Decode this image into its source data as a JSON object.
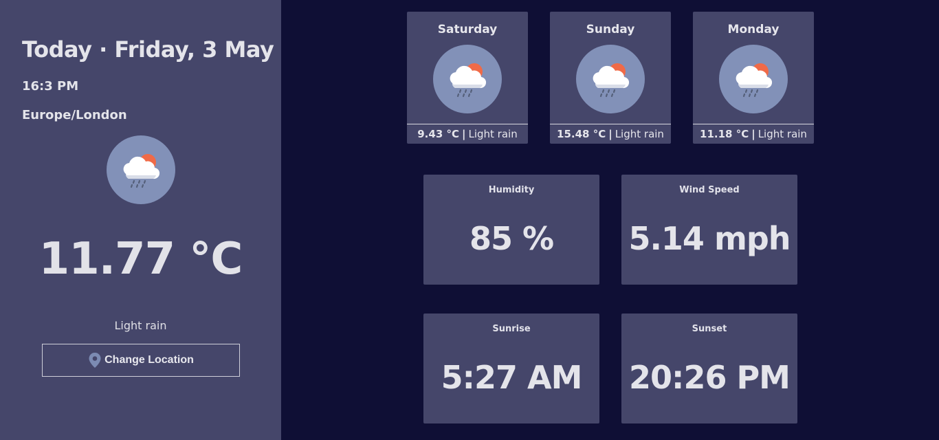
{
  "today": {
    "title": "Today · Friday, 3 May",
    "time": "16:3 PM",
    "timezone": "Europe/London",
    "temperature": "11.77 °C",
    "description": "Light rain",
    "icon": "cloud-rain-sun-icon",
    "change_location_label": "Change Location"
  },
  "forecast": [
    {
      "day": "Saturday",
      "temp": "9.43 °C",
      "separator": "|",
      "description": "Light rain",
      "icon": "cloud-rain-sun-icon"
    },
    {
      "day": "Sunday",
      "temp": "15.48 °C",
      "separator": "|",
      "description": "Light rain",
      "icon": "cloud-rain-sun-icon"
    },
    {
      "day": "Monday",
      "temp": "11.18 °C",
      "separator": "|",
      "description": "Light rain",
      "icon": "cloud-rain-sun-icon"
    }
  ],
  "stats": {
    "humidity": {
      "label": "Humidity",
      "value": "85 %"
    },
    "wind": {
      "label": "Wind Speed",
      "value": "5.14 mph"
    },
    "sunrise": {
      "label": "Sunrise",
      "value": "5:27 AM"
    },
    "sunset": {
      "label": "Sunset",
      "value": "20:26 PM"
    }
  },
  "colors": {
    "background": "#0f0f35",
    "panel": "#45466a",
    "icon_circle": "#8291b8",
    "sun": "#f06a47",
    "text": "#e4e4ea"
  }
}
